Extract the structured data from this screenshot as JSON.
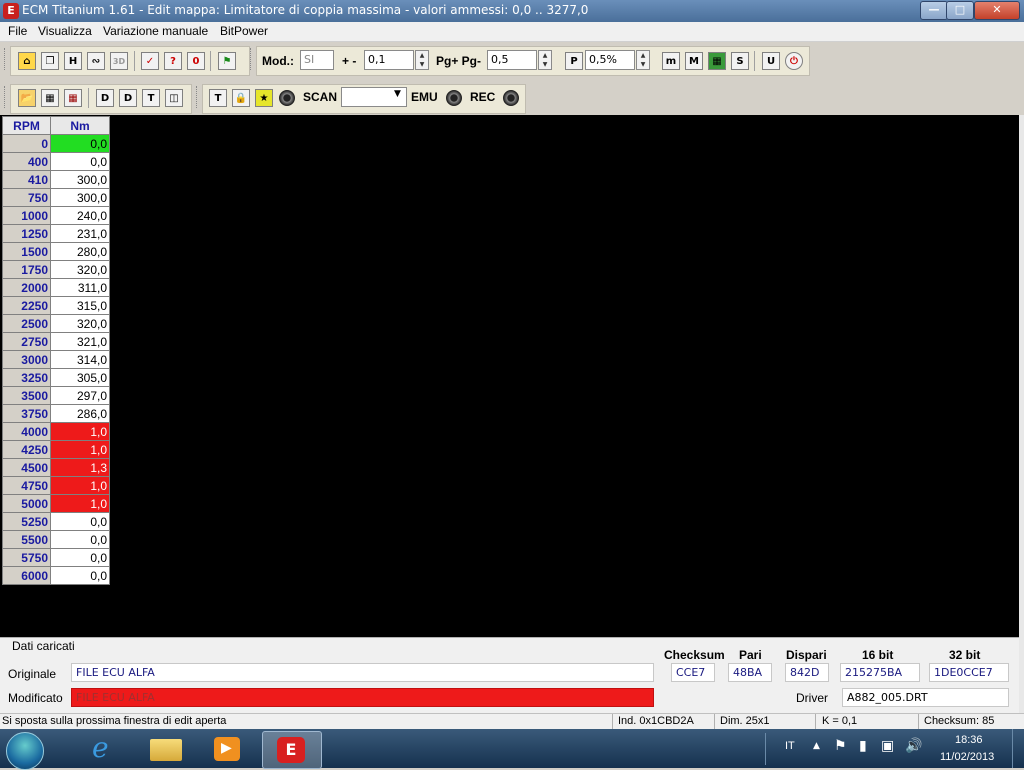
{
  "window": {
    "icon_letter": "E",
    "title": "ECM Titanium 1.61 - Edit mappa: Limitatore di coppia massima - valori ammessi: 0,0 .. 3277,0"
  },
  "menu": [
    "File",
    "Visualizza",
    "Variazione manuale",
    "BitPower"
  ],
  "toolbar1": {
    "mod_label": "Mod.:",
    "mod_value": "SI",
    "plusminus_label": "+ -",
    "plusminus_value": "0,1",
    "pg_label": "Pg+ Pg-",
    "pg_value": "0,5",
    "pct_value": "0,5%",
    "btn_3d": "3D",
    "btn_p": "P",
    "btn_m_small": "m",
    "btn_m_big": "M",
    "btn_s": "S",
    "btn_u": "U",
    "btn_h": "H",
    "btn_0": "0"
  },
  "toolbar2": {
    "scan_label": "SCAN",
    "scan_value": "",
    "emu_label": "EMU",
    "rec_label": "REC",
    "btn_d1": "D",
    "btn_d2": "D",
    "btn_t1": "T",
    "btn_t2": "T"
  },
  "table": {
    "col_rpm": "RPM",
    "col_nm": "Nm",
    "rows": [
      {
        "rpm": "0",
        "nm": "0,0",
        "state": "green"
      },
      {
        "rpm": "400",
        "nm": "0,0",
        "state": "normal"
      },
      {
        "rpm": "410",
        "nm": "300,0",
        "state": "normal"
      },
      {
        "rpm": "750",
        "nm": "300,0",
        "state": "normal"
      },
      {
        "rpm": "1000",
        "nm": "240,0",
        "state": "normal"
      },
      {
        "rpm": "1250",
        "nm": "231,0",
        "state": "normal"
      },
      {
        "rpm": "1500",
        "nm": "280,0",
        "state": "normal"
      },
      {
        "rpm": "1750",
        "nm": "320,0",
        "state": "normal"
      },
      {
        "rpm": "2000",
        "nm": "311,0",
        "state": "normal"
      },
      {
        "rpm": "2250",
        "nm": "315,0",
        "state": "normal"
      },
      {
        "rpm": "2500",
        "nm": "320,0",
        "state": "normal"
      },
      {
        "rpm": "2750",
        "nm": "321,0",
        "state": "normal"
      },
      {
        "rpm": "3000",
        "nm": "314,0",
        "state": "normal"
      },
      {
        "rpm": "3250",
        "nm": "305,0",
        "state": "normal"
      },
      {
        "rpm": "3500",
        "nm": "297,0",
        "state": "normal"
      },
      {
        "rpm": "3750",
        "nm": "286,0",
        "state": "normal"
      },
      {
        "rpm": "4000",
        "nm": "1,0",
        "state": "red"
      },
      {
        "rpm": "4250",
        "nm": "1,0",
        "state": "red"
      },
      {
        "rpm": "4500",
        "nm": "1,3",
        "state": "red"
      },
      {
        "rpm": "4750",
        "nm": "1,0",
        "state": "red"
      },
      {
        "rpm": "5000",
        "nm": "1,0",
        "state": "red"
      },
      {
        "rpm": "5250",
        "nm": "0,0",
        "state": "normal"
      },
      {
        "rpm": "5500",
        "nm": "0,0",
        "state": "normal"
      },
      {
        "rpm": "5750",
        "nm": "0,0",
        "state": "normal"
      },
      {
        "rpm": "6000",
        "nm": "0,0",
        "state": "normal"
      }
    ]
  },
  "panel": {
    "section_title": "Dati caricati",
    "originale_label": "Originale",
    "originale_value": "FILE ECU ALFA",
    "modificato_label": "Modificato",
    "modificato_value": "FILE ECU ALFA",
    "checksum_header": "Checksum",
    "pari_header": "Pari",
    "dispari_header": "Dispari",
    "bit16_header": "16 bit",
    "bit32_header": "32 bit",
    "checksum_value": "CCE7",
    "pari_value": "48BA",
    "dispari_value": "842D",
    "bit16_value": "215275BA",
    "bit32_value": "1DE0CCE7",
    "driver_label": "Driver",
    "driver_value": "A882_005.DRT"
  },
  "status": {
    "hint": "Si sposta sulla prossima finestra di edit aperta",
    "ind": "Ind. 0x1CBD2A",
    "dim": "Dim. 25x1",
    "k": "K = 0,1",
    "checksum": "Checksum: 85"
  },
  "taskbar": {
    "lang": "IT",
    "time": "18:36",
    "date": "11/02/2013"
  },
  "colors": {
    "green_cell": "#22dd22",
    "red_cell": "#ee1a1a",
    "rpm_text": "#1a1aa0"
  }
}
